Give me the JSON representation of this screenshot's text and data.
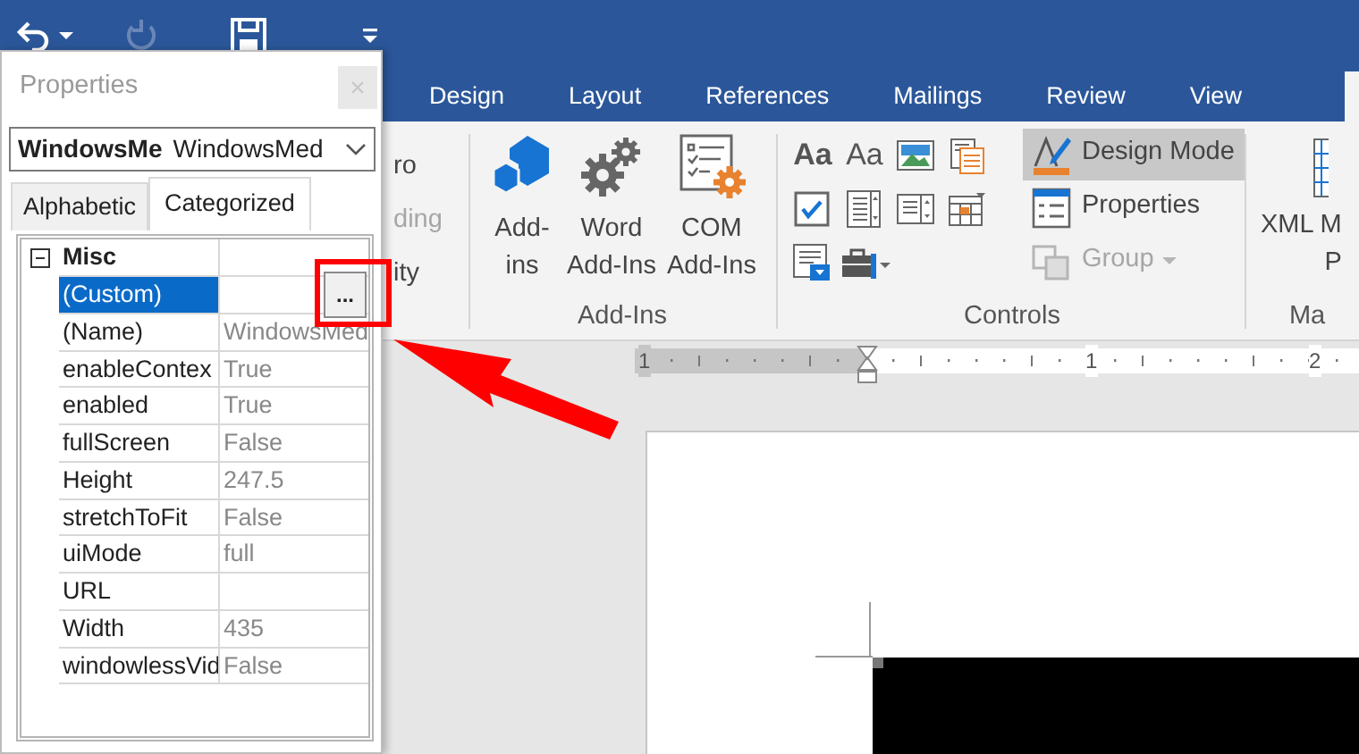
{
  "quick_access": [
    {
      "kind": "undo",
      "disabled": false
    },
    {
      "kind": "undo-menu",
      "disabled": false
    },
    {
      "kind": "redo",
      "disabled": true
    },
    {
      "kind": "save",
      "disabled": false
    },
    {
      "kind": "customize",
      "disabled": false
    }
  ],
  "ribbon_tabs": [
    {
      "label": "Design",
      "selected": false
    },
    {
      "label": "Layout",
      "selected": false
    },
    {
      "label": "References",
      "selected": false
    },
    {
      "label": "Mailings",
      "selected": false
    },
    {
      "label": "Review",
      "selected": false
    },
    {
      "label": "View",
      "selected": false
    }
  ],
  "ribbon": {
    "partial_column": [
      {
        "label": "ro",
        "disabled": false
      },
      {
        "label": "ding",
        "disabled": true
      },
      {
        "label": "ity",
        "disabled": false
      }
    ],
    "add_ins": {
      "label": "Add-Ins",
      "buttons": [
        {
          "kind": "store",
          "lines": [
            "Add-",
            "ins"
          ]
        },
        {
          "kind": "gears",
          "lines": [
            "Word",
            "Add-Ins"
          ]
        },
        {
          "kind": "com",
          "lines": [
            "COM",
            "Add-Ins"
          ]
        }
      ]
    },
    "controls": {
      "label": "Controls",
      "tools": [
        {
          "kind": "rich-text",
          "glyph": "Aa"
        },
        {
          "kind": "plain-text",
          "glyph": "Aa"
        },
        {
          "kind": "picture"
        },
        {
          "kind": "gallery"
        },
        {
          "kind": "checkbox"
        },
        {
          "kind": "combo"
        },
        {
          "kind": "dropdown"
        },
        {
          "kind": "date"
        },
        {
          "kind": "repeating"
        },
        {
          "kind": "legacy"
        }
      ],
      "buttons": [
        {
          "kind": "design",
          "label": "Design Mode",
          "selected": true,
          "disabled": false
        },
        {
          "kind": "properties",
          "label": "Properties",
          "selected": false,
          "disabled": false
        },
        {
          "kind": "group",
          "label": "Group",
          "selected": false,
          "disabled": true
        }
      ]
    },
    "xml": {
      "lines": [
        "XML M",
        "P"
      ],
      "label": "Ma"
    }
  },
  "ruler": {
    "labels": [
      "1",
      "1",
      "2"
    ]
  },
  "properties_window": {
    "title": "Properties",
    "object_name": "WindowsMe",
    "object_type": "WindowsMed",
    "tabs": [
      {
        "label": "Alphabetic",
        "selected": false
      },
      {
        "label": "Categorized",
        "selected": true
      }
    ],
    "category": {
      "label": "Misc",
      "expanded": true
    },
    "rows": [
      {
        "name": "(Custom)",
        "selected": true,
        "button": "..."
      },
      {
        "name": "(Name)",
        "value": "WindowsMed",
        "selected": false
      },
      {
        "name": "enableContex",
        "value": "True",
        "selected": false
      },
      {
        "name": "enabled",
        "value": "True",
        "selected": false
      },
      {
        "name": "fullScreen",
        "value": "False",
        "selected": false
      },
      {
        "name": "Height",
        "value": "247.5",
        "selected": false
      },
      {
        "name": "stretchToFit",
        "value": "False",
        "selected": false
      },
      {
        "name": "uiMode",
        "value": "full",
        "selected": false
      },
      {
        "name": "URL",
        "selected": false
      },
      {
        "name": "Width",
        "value": "435",
        "selected": false
      },
      {
        "name": "windowlessVid",
        "value": "False",
        "selected": false
      }
    ]
  }
}
